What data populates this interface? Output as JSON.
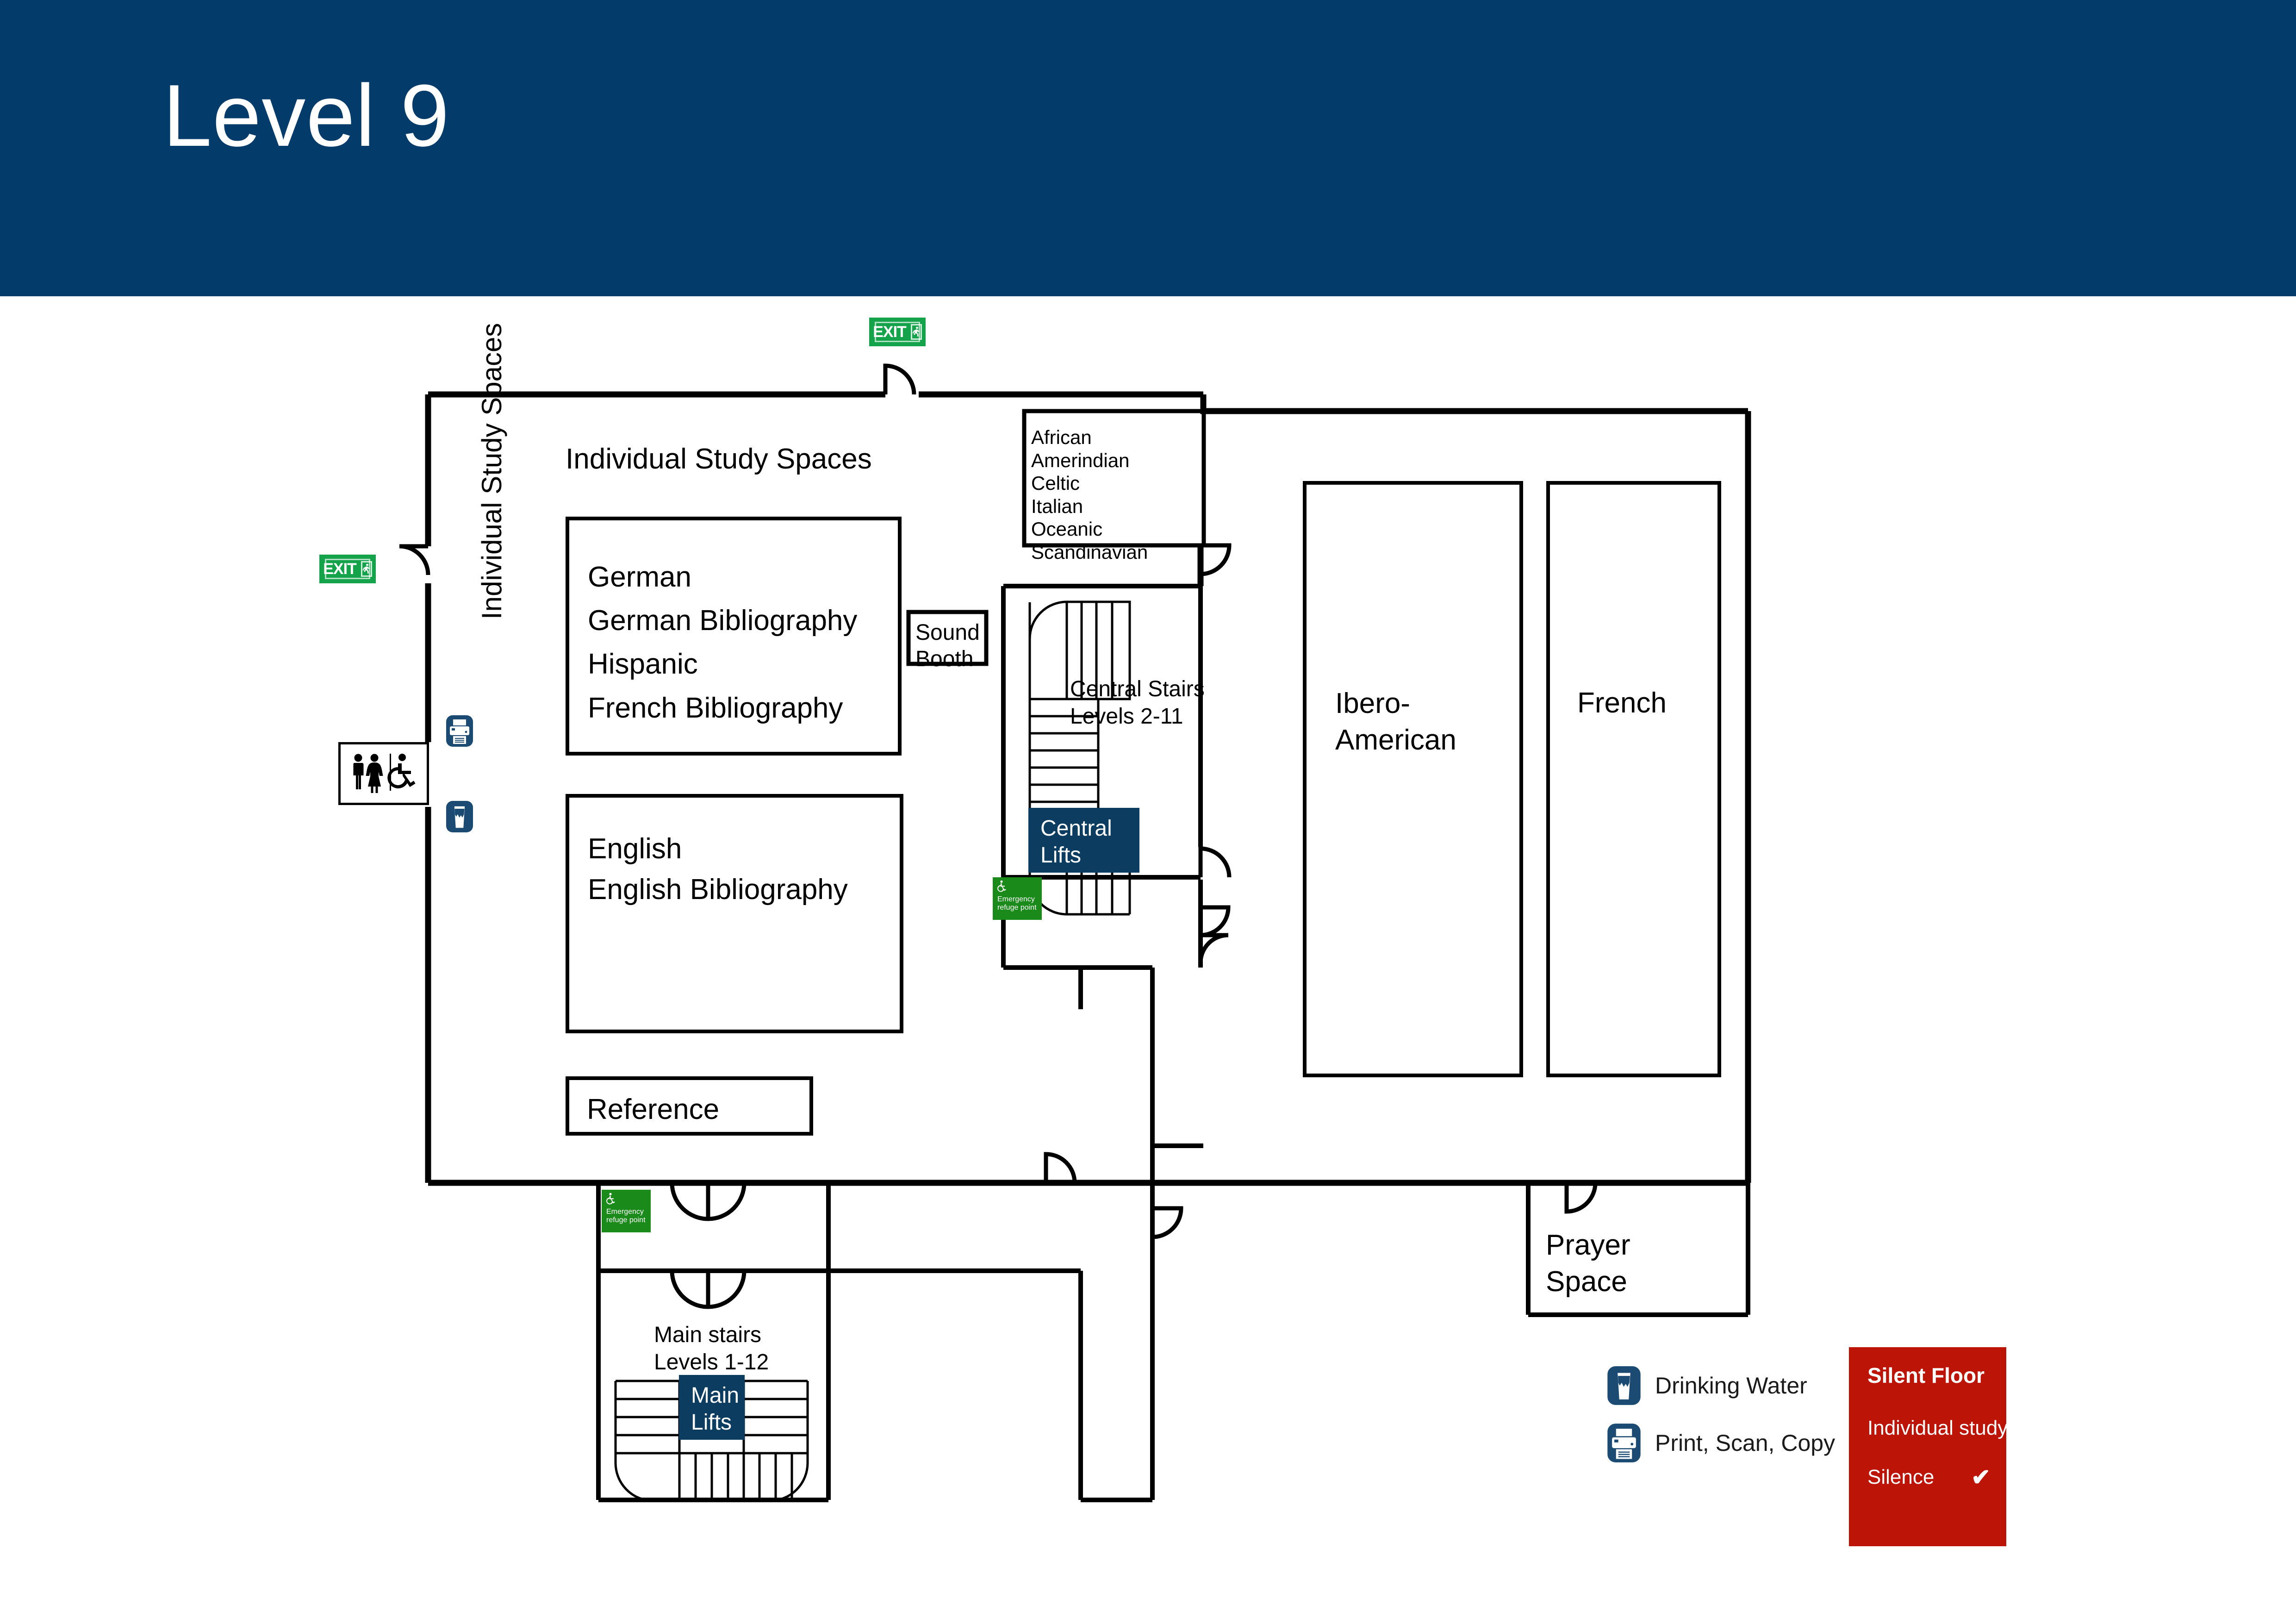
{
  "header": {
    "title": "Level 9",
    "background_color": "#033c6a",
    "text_color": "#ffffff"
  },
  "floorplan": {
    "area_label_top": "Individual Study Spaces",
    "area_label_vertical": "Individual Study Spaces",
    "rooms": [
      {
        "id": "languages-box",
        "lines": "German\nGerman Bibliography\nHispanic\nFrench Bibliography"
      },
      {
        "id": "english-box",
        "lines": "English\nEnglish Bibliography"
      },
      {
        "id": "reference-box",
        "label": "Reference"
      },
      {
        "id": "minor-collections-box",
        "lines": "African\nAmerindian\nCeltic\nItalian\nOceanic\nScandinavian"
      },
      {
        "id": "sound-booth",
        "label": "Sound\nBooth"
      },
      {
        "id": "ibero-american-room",
        "label": "Ibero-\nAmerican"
      },
      {
        "id": "french-room",
        "label": "French"
      },
      {
        "id": "prayer-space",
        "label": "Prayer\nSpace"
      }
    ],
    "circulation": {
      "central_stairs": "Central Stairs\nLevels 2-11",
      "central_lifts": "Central\nLifts",
      "main_stairs": "Main stairs\nLevels 1-12",
      "main_lifts": "Main\nLifts"
    },
    "signs": {
      "exit_label": "EXIT",
      "exit_icon": "running-person-icon",
      "refuge_label": "Emergency\nrefuge point",
      "refuge_icon": "wheelchair-icon",
      "toilets_icon": "toilets-icon",
      "exit_color": "#14a34a",
      "refuge_color": "#1a8a1a"
    }
  },
  "legend": {
    "items": [
      {
        "icon": "drinking-water-icon",
        "label": "Drinking Water"
      },
      {
        "icon": "printer-icon",
        "label": "Print, Scan, Copy"
      }
    ],
    "icon_color": "#1b4a73"
  },
  "silent_floor": {
    "title": "Silent Floor",
    "background_color": "#bd1408",
    "rules": [
      {
        "label": "Individual study",
        "checked": "✔"
      },
      {
        "label": "Silence",
        "checked": "✔"
      }
    ]
  }
}
